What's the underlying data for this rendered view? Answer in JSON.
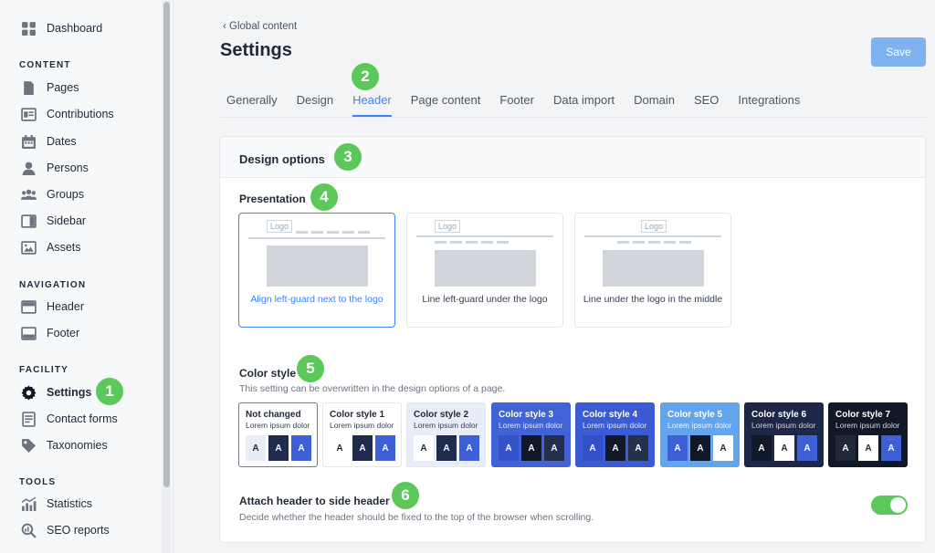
{
  "sidebar": {
    "dashboard": "Dashboard",
    "sections": {
      "content": "CONTENT",
      "navigation": "NAVIGATION",
      "facility": "FACILITY",
      "tools": "TOOLS"
    },
    "items": {
      "pages": "Pages",
      "contributions": "Contributions",
      "dates": "Dates",
      "persons": "Persons",
      "groups": "Groups",
      "sidebar": "Sidebar",
      "assets": "Assets",
      "header": "Header",
      "footer": "Footer",
      "settings": "Settings",
      "contact_forms": "Contact forms",
      "taxonomies": "Taxonomies",
      "statistics": "Statistics",
      "seo_reports": "SEO reports"
    }
  },
  "badges": [
    "1",
    "2",
    "3",
    "4",
    "5",
    "6"
  ],
  "breadcrumb": "Global content",
  "page_title": "Settings",
  "save_label": "Save",
  "tabs": [
    "Generally",
    "Design",
    "Header",
    "Page content",
    "Footer",
    "Data import",
    "Domain",
    "SEO",
    "Integrations"
  ],
  "active_tab": "Header",
  "card_title": "Design options",
  "presentation": {
    "title": "Presentation",
    "logo_text": "Logo",
    "options": [
      "Align left-guard next to the logo",
      "Line left-guard under the logo",
      "Line under the logo in the middle"
    ],
    "selected": 0
  },
  "color_style": {
    "title": "Color style",
    "description": "This setting can be overwritten in the design options of a page.",
    "sample_text": "Lorem ipsum dolor",
    "swatch_letter": "A",
    "styles": [
      "Not changed",
      "Color style 1",
      "Color style 2",
      "Color style 3",
      "Color style 4",
      "Color style 5",
      "Color style 6",
      "Color style 7"
    ],
    "selected": 0
  },
  "attach_header": {
    "title": "Attach header to side header",
    "description": "Decide whether the header should be fixed to the top of the browser when scrolling.",
    "enabled": true
  },
  "colors": {
    "accent": "#3b82f6",
    "badge": "#5cc85a",
    "save": "#7fb2ee"
  }
}
